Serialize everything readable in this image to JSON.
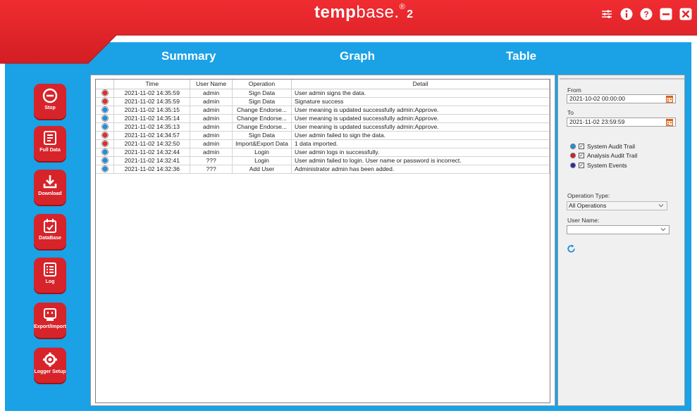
{
  "app": {
    "logo_part1": "temp",
    "logo_part2": "base.",
    "logo_reg": "®",
    "logo_version": "2"
  },
  "tabs": [
    {
      "label": "Summary"
    },
    {
      "label": "Graph"
    },
    {
      "label": "Table"
    }
  ],
  "sidebar": {
    "items": [
      {
        "label": "Stop",
        "icon": "stop-icon"
      },
      {
        "label": "Full Data",
        "icon": "full-data-icon"
      },
      {
        "label": "Download",
        "icon": "download-icon"
      },
      {
        "label": "DataBase",
        "icon": "database-icon"
      },
      {
        "label": "Log",
        "icon": "log-icon"
      },
      {
        "label": "Export/Import",
        "icon": "export-import-icon"
      },
      {
        "label": "Logger Setup",
        "icon": "logger-setup-icon"
      }
    ]
  },
  "table": {
    "columns": [
      "",
      "Time",
      "User Name",
      "Operation",
      "Detail"
    ],
    "rows": [
      {
        "status": "red",
        "time": "2021-11-02 14:35:59",
        "user": "admin",
        "operation": "Sign Data",
        "detail": "User admin signs the data."
      },
      {
        "status": "red",
        "time": "2021-11-02 14:35:59",
        "user": "admin",
        "operation": "Sign Data",
        "detail": "Signature success"
      },
      {
        "status": "blue",
        "time": "2021-11-02 14:35:15",
        "user": "admin",
        "operation": "Change Endorse...",
        "detail": "User meaning is updated successfully admin:Approve."
      },
      {
        "status": "blue",
        "time": "2021-11-02 14:35:14",
        "user": "admin",
        "operation": "Change Endorse...",
        "detail": "User meaning is updated successfully admin:Approve."
      },
      {
        "status": "blue",
        "time": "2021-11-02 14:35:13",
        "user": "admin",
        "operation": "Change Endorse...",
        "detail": "User meaning is updated successfully admin:Approve."
      },
      {
        "status": "red",
        "time": "2021-11-02 14:34:57",
        "user": "admin",
        "operation": "Sign Data",
        "detail": "User admin failed to sign the data."
      },
      {
        "status": "red",
        "time": "2021-11-02 14:32:50",
        "user": "admin",
        "operation": "Import&Export Data",
        "detail": "1 data imported."
      },
      {
        "status": "blue",
        "time": "2021-11-02 14:32:44",
        "user": "admin",
        "operation": "Login",
        "detail": "User admin logs in successfully."
      },
      {
        "status": "blue",
        "time": "2021-11-02 14:32:41",
        "user": "???",
        "operation": "Login",
        "detail": "User admin failed to login. User name or password is incorrect."
      },
      {
        "status": "blue",
        "time": "2021-11-02 14:32:36",
        "user": "???",
        "operation": "Add User",
        "detail": "Administrator admin has been added."
      }
    ]
  },
  "filters": {
    "from_label": "From",
    "from_value": "2021-10-02 00:00:00",
    "to_label": "To",
    "to_value": "2021-11-02 23:59:59",
    "legend": [
      {
        "label": "System Audit Trail",
        "color": "#1f8fe0",
        "checked": true
      },
      {
        "label": "Analysis Audit Trail",
        "color": "#d62020",
        "checked": true
      },
      {
        "label": "System Events",
        "color": "#2a2ab8",
        "checked": true
      }
    ],
    "operation_type_label": "Operation Type:",
    "operation_type_value": "All Operations",
    "user_name_label": "User Name:",
    "user_name_value": ""
  },
  "colors": {
    "header_red": "#e3262b",
    "frame_blue": "#1aa1e6",
    "accent_blue": "#1f8fe0"
  }
}
